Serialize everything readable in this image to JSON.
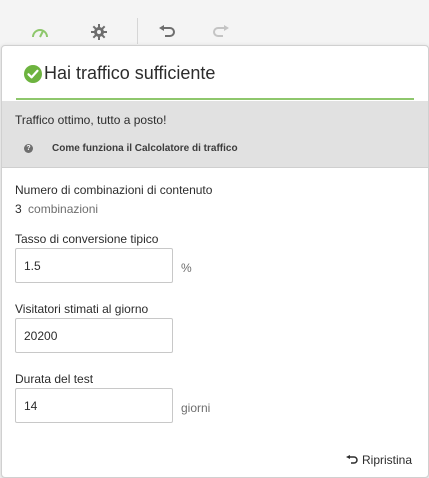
{
  "toolbar": {
    "icons": [
      "gauge-icon",
      "gear-icon",
      "undo-icon",
      "redo-icon"
    ],
    "accent": "#8ec76c"
  },
  "panel": {
    "title": "Hai traffico sufficiente",
    "status_color": "#6db33f",
    "message": "Traffico ottimo, tutto a posto!",
    "help_link": "Come funziona il Calcolatore di traffico"
  },
  "combinations": {
    "label": "Numero di combinazioni di contenuto",
    "count": "3",
    "unit": "combinazioni"
  },
  "conversion": {
    "label": "Tasso di conversione tipico",
    "value": "1.5",
    "suffix": "%"
  },
  "visitors": {
    "label": "Visitatori stimati al giorno",
    "value": "20200"
  },
  "duration": {
    "label": "Durata del test",
    "value": "14",
    "suffix": "giorni"
  },
  "reset": {
    "label": "Ripristina"
  }
}
